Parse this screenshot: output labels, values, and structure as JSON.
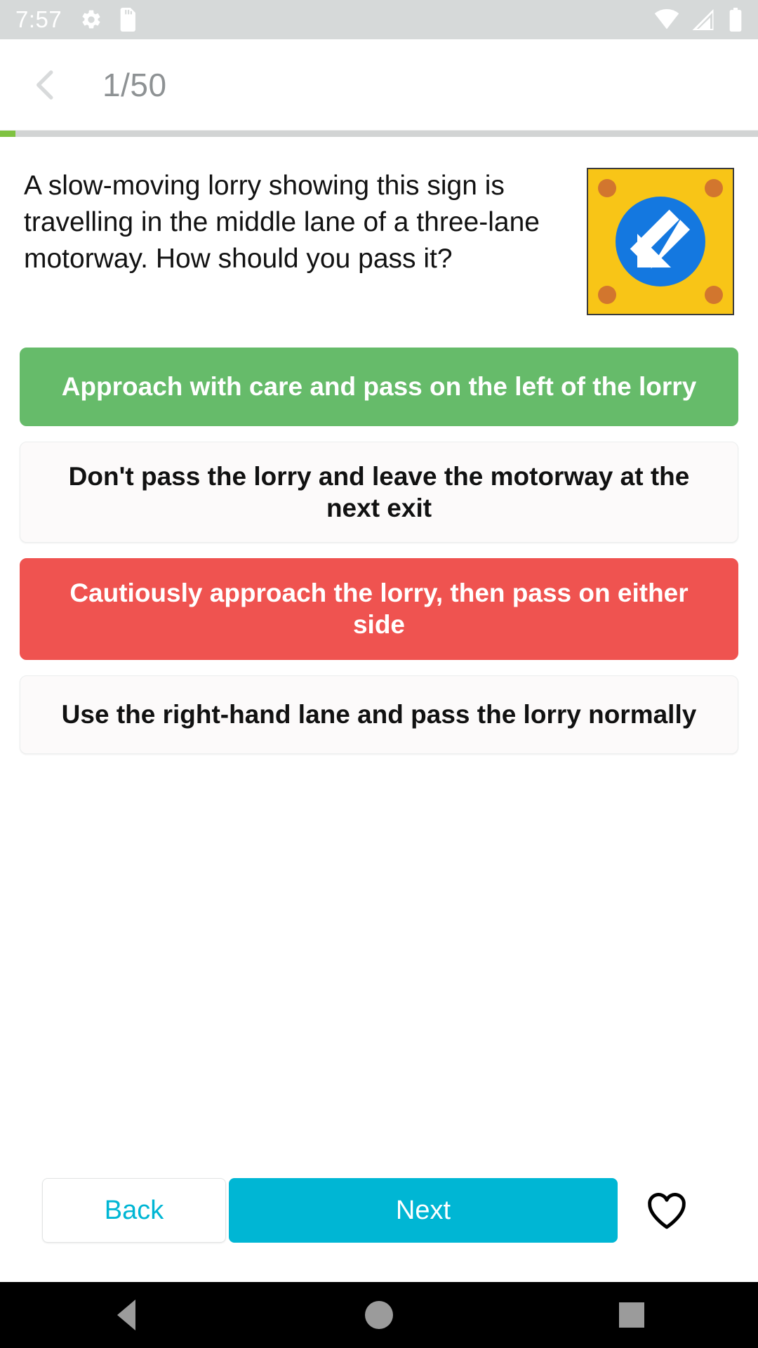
{
  "statusbar": {
    "time": "7:57",
    "left_icons": [
      "gear-icon",
      "sd-card-icon"
    ],
    "right_icons": [
      "wifi-icon",
      "signal-icon",
      "battery-icon"
    ],
    "background": "#d6d9d9"
  },
  "appbar": {
    "back_icon": "chevron-left-icon",
    "title": "1/50"
  },
  "progress": {
    "percent": 2,
    "fill_color": "#7fc241",
    "track_color": "#d2d4d4"
  },
  "question": {
    "text": "A slow-moving lorry showing this sign is travelling in the middle lane of a three-lane motorway. How should you pass it?",
    "image": {
      "name": "slow-moving-vehicle-arrow-sign",
      "plate_color": "#F8C517",
      "circle_color": "#1478E0",
      "bolt_color": "#D2762E",
      "arrow_direction": "down-left",
      "arrow_color": "#FFFFFF"
    }
  },
  "answers": [
    {
      "label": "Approach with care and pass on the left of the lorry",
      "state": "correct",
      "bg": "#66BB6A",
      "fg": "#FFFFFF"
    },
    {
      "label": "Don't pass the lorry and leave the motorway at the next exit",
      "state": "neutral",
      "bg": "#FCFAFA",
      "fg": "#111111"
    },
    {
      "label": "Cautiously approach the lorry, then pass on either side",
      "state": "wrong",
      "bg": "#EF5350",
      "fg": "#FFFFFF"
    },
    {
      "label": "Use the right-hand lane and pass the lorry normally",
      "state": "neutral",
      "bg": "#FCFAFA",
      "fg": "#111111"
    }
  ],
  "footer": {
    "back_label": "Back",
    "next_label": "Next",
    "favorite_icon": "heart-outline-icon",
    "accent_color": "#00B6D4"
  },
  "navbar": {
    "back": "triangle-back-icon",
    "home": "circle-home-icon",
    "recent": "square-recents-icon"
  }
}
